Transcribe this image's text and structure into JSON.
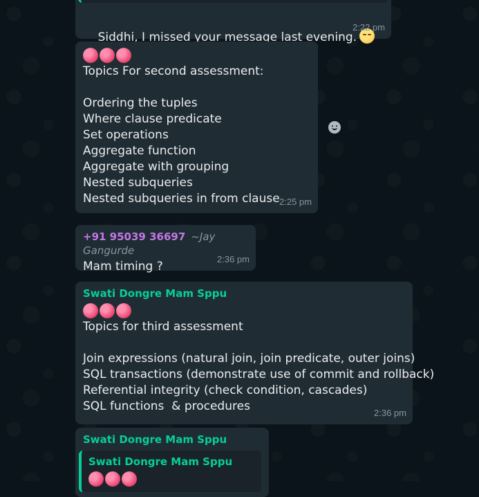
{
  "messages": [
    {
      "text": "Siddhi, I missed your message last evening.",
      "emoji": "pensive-face",
      "time": "2:22 pm"
    },
    {
      "dots": "🔴🔴🔴",
      "lines": [
        "Topics For second assessment:",
        "",
        "Ordering the tuples",
        "Where clause predicate",
        "Set operations",
        "Aggregate function",
        "Aggregate with grouping",
        "Nested subqueries",
        "Nested subqueries in from clause"
      ],
      "time": "2:25 pm"
    },
    {
      "sender_phone": "+91 95039 36697",
      "sender_name": "~Jay Gangurde",
      "text": "Mam timing ?",
      "time": "2:36 pm"
    },
    {
      "sender": "Swati Dongre Mam Sppu",
      "lines": [
        "Topics for third assessment",
        "",
        "Join expressions (natural join, join predicate, outer joins)",
        "SQL transactions (demonstrate use of commit and rollback)",
        "Referential integrity (check condition, cascades)",
        "SQL functions  & procedures"
      ],
      "time": "2:36 pm"
    },
    {
      "sender": "Swati Dongre Mam Sppu",
      "quoted_sender": "Swati Dongre Mam Sppu"
    }
  ],
  "colors": {
    "background": "#0b141a",
    "bubble": "#202c33",
    "sender_green": "#06cf9c",
    "phone_purple": "#c278e6",
    "timestamp": "#8696a0"
  }
}
